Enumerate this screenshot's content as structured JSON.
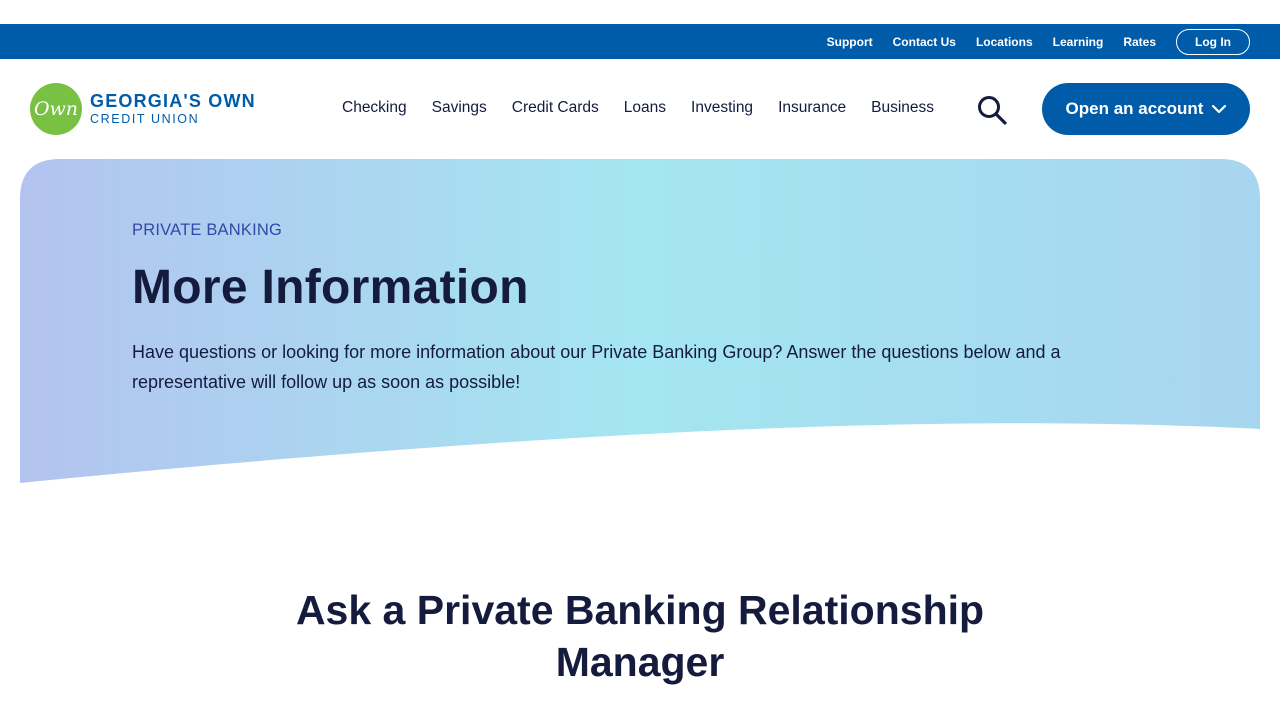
{
  "utility_nav": {
    "links": [
      "Support",
      "Contact Us",
      "Locations",
      "Learning",
      "Rates"
    ],
    "login_label": "Log In"
  },
  "brand": {
    "badge_text": "Own",
    "name_line1": "GEORGIA'S OWN",
    "name_line2": "CREDIT UNION",
    "badge_color": "#78c143",
    "primary_color": "#005ca9"
  },
  "main_nav": {
    "links": [
      "Checking",
      "Savings",
      "Credit Cards",
      "Loans",
      "Investing",
      "Insurance",
      "Business"
    ],
    "search_icon": "search-icon",
    "cta_label": "Open an account",
    "cta_icon": "chevron-down-icon"
  },
  "hero": {
    "eyebrow": "PRIVATE BANKING",
    "title": "More Information",
    "description": "Have questions or looking for more information about our Private Banking Group? Answer the questions below and a representative will follow up as soon as possible!"
  },
  "section": {
    "title": "Ask a Private Banking Relationship Manager"
  }
}
